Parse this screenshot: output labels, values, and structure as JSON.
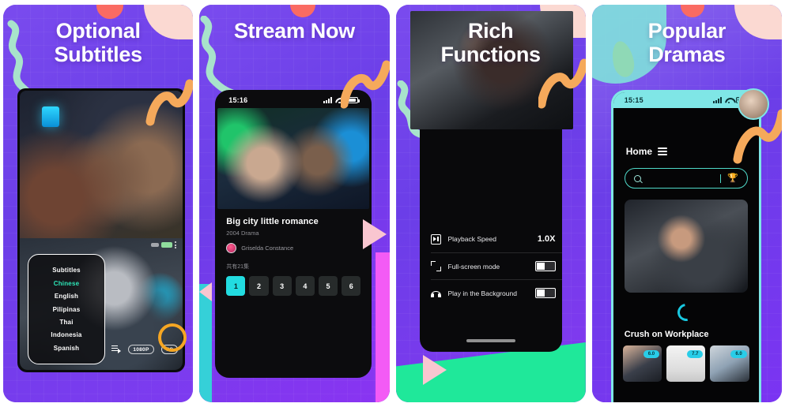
{
  "gallery": {
    "panels": [
      {
        "id": "panel-optional-subtitles",
        "title": "Optional\nSubtitles",
        "accent": "#6B3EE8",
        "status_bar": {
          "time": "",
          "signal_icon": "signal-icon",
          "wifi_icon": "wifi-icon",
          "battery_icon": "battery-icon"
        },
        "subtitle_menu": {
          "heading": "Subtitles",
          "options": [
            {
              "label": "Chinese",
              "selected": true
            },
            {
              "label": "English",
              "selected": false
            },
            {
              "label": "Pilipinas",
              "selected": false
            },
            {
              "label": "Thai",
              "selected": false
            },
            {
              "label": "Indonesia",
              "selected": false
            },
            {
              "label": "Spanish",
              "selected": false
            }
          ],
          "active_color": "#2ee6b8"
        },
        "player_controls": {
          "playlist_icon": "playlist-icon",
          "resolution_badge": "1080P",
          "cc_badge": "CC",
          "highlight_color": "#F5A623"
        }
      },
      {
        "id": "panel-stream-now",
        "title": "Stream Now",
        "accent": "#6B3EE8",
        "status_bar": {
          "time": "15:16",
          "signal_icon": "signal-icon",
          "wifi_icon": "wifi-icon",
          "battery_icon": "battery-icon"
        },
        "detail": {
          "title": "Big city little romance",
          "meta": "2004 Drama",
          "uploader": "Griselda Constance",
          "avatar_icon": "avatar-icon",
          "episodes_label": "共有21集",
          "episodes": [
            "1",
            "2",
            "3",
            "4",
            "5",
            "6"
          ],
          "active_episode": "1",
          "active_color": "#22DCE0"
        }
      },
      {
        "id": "panel-rich-functions",
        "title": "Rich\nFunctions",
        "accent": "#6B3EE8",
        "settings": [
          {
            "icon": "playback-speed-icon",
            "label": "Playback Speed",
            "value": "1.0X",
            "control": "value"
          },
          {
            "icon": "fullscreen-icon",
            "label": "Full-screen mode",
            "value": "",
            "control": "toggle"
          },
          {
            "icon": "headphones-icon",
            "label": "Play in the Background",
            "value": "",
            "control": "toggle"
          }
        ],
        "wedge_color": "#1FE89A"
      },
      {
        "id": "panel-popular-dramas",
        "title": "Popular\nDramas",
        "accent": "#6B3EE8",
        "status_bar": {
          "time": "15:15",
          "signal_icon": "signal-icon",
          "wifi_icon": "wifi-icon",
          "battery_icon": "battery-icon"
        },
        "home": {
          "nav_label": "Home",
          "menu_icon": "hamburger-menu-icon",
          "search_placeholder": "",
          "search_icon": "search-icon",
          "trophy_icon": "trophy-icon",
          "loading_icon": "loading-spinner-icon",
          "section_title": "Crush on Workplace",
          "thumbnails": [
            {
              "badge": "6.0"
            },
            {
              "badge": "7.7"
            },
            {
              "badge": "6.0"
            }
          ],
          "badge_color": "#29CDE8",
          "frame_color": "#7FE6E6"
        }
      }
    ]
  }
}
